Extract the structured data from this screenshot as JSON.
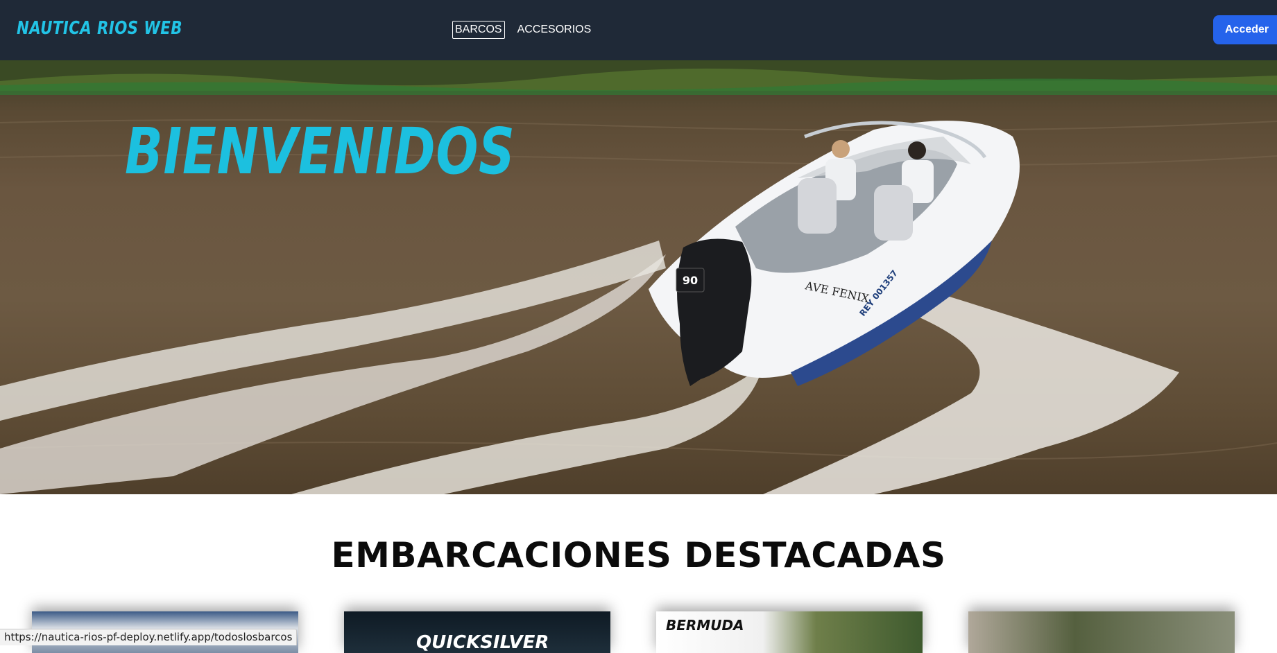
{
  "nav": {
    "brand": "NAUTICA RIOS WEB",
    "links": [
      {
        "label": "BARCOS",
        "active": true
      },
      {
        "label": "ACCESORIOS",
        "active": false
      }
    ],
    "login_label": "Acceder"
  },
  "hero": {
    "title": "BIENVENIDOS",
    "boat_motor_label": "90",
    "boat_name": "AVE FENIX",
    "boat_registration": "REY 001357"
  },
  "featured": {
    "title": "EMBARCACIONES DESTACADAS",
    "cards": [
      {
        "label": ""
      },
      {
        "label": "QUICKSILVER"
      },
      {
        "label": "BERMUDA"
      },
      {
        "label": ""
      }
    ]
  },
  "status_bar": {
    "url": "https://nautica-rios-pf-deploy.netlify.app/todoslosbarcos"
  },
  "colors": {
    "navbar": "#1f2937",
    "brand": "#22c3e6",
    "accent_button": "#2563eb",
    "hero_title": "#1cc0df"
  }
}
